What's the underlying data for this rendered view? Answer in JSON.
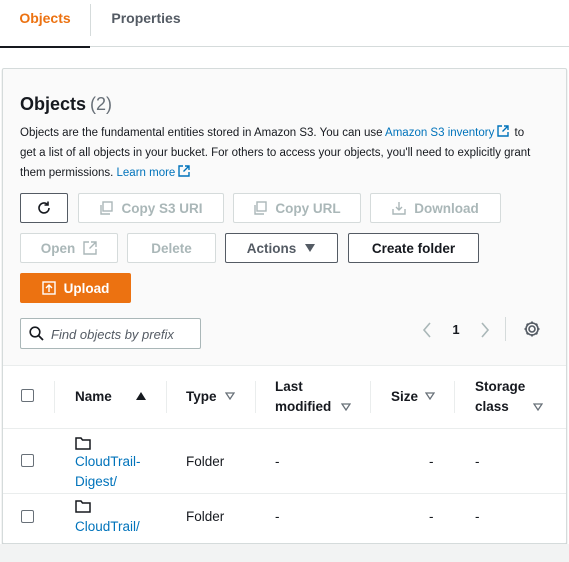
{
  "tabs": [
    {
      "label": "Objects",
      "active": true
    },
    {
      "label": "Properties",
      "active": false
    }
  ],
  "panel": {
    "title": "Objects",
    "count": "(2)",
    "description": {
      "part1": "Objects are the fundamental entities stored in Amazon S3. You can use ",
      "link1": "Amazon S3 inventory",
      "part2": " to get a list of all objects in your bucket. For others to access your objects, you'll need to explicitly grant them permissions. ",
      "link2": "Learn more"
    }
  },
  "toolbar": {
    "refresh_icon": "refresh-icon",
    "copy_s3_uri": "Copy S3 URI",
    "copy_url": "Copy URL",
    "download": "Download",
    "open": "Open",
    "delete": "Delete",
    "actions": "Actions",
    "create_folder": "Create folder",
    "upload": "Upload"
  },
  "search": {
    "placeholder": "Find objects by prefix",
    "value": ""
  },
  "pagination": {
    "current_page": "1"
  },
  "table": {
    "columns": [
      {
        "label": "Name",
        "sort": "ascending"
      },
      {
        "label": "Type"
      },
      {
        "label": "Last modified"
      },
      {
        "label": "Size"
      },
      {
        "label": "Storage class"
      }
    ],
    "column_label_lines": {
      "last_modified": [
        "Last",
        "modified"
      ],
      "storage_class": [
        "Storage",
        "class"
      ]
    },
    "rows": [
      {
        "name_lines": [
          "CloudTrail-",
          "Digest/"
        ],
        "type": "Folder",
        "last_modified": "-",
        "size": "-",
        "storage_class": "-"
      },
      {
        "name_lines": [
          "CloudTrail/"
        ],
        "type": "Folder",
        "last_modified": "-",
        "size": "-",
        "storage_class": "-"
      }
    ]
  },
  "colors": {
    "accent": "#ec7211",
    "link": "#0073bb",
    "text": "#16191f",
    "muted": "#545b64",
    "disabled": "#aab7b8"
  }
}
